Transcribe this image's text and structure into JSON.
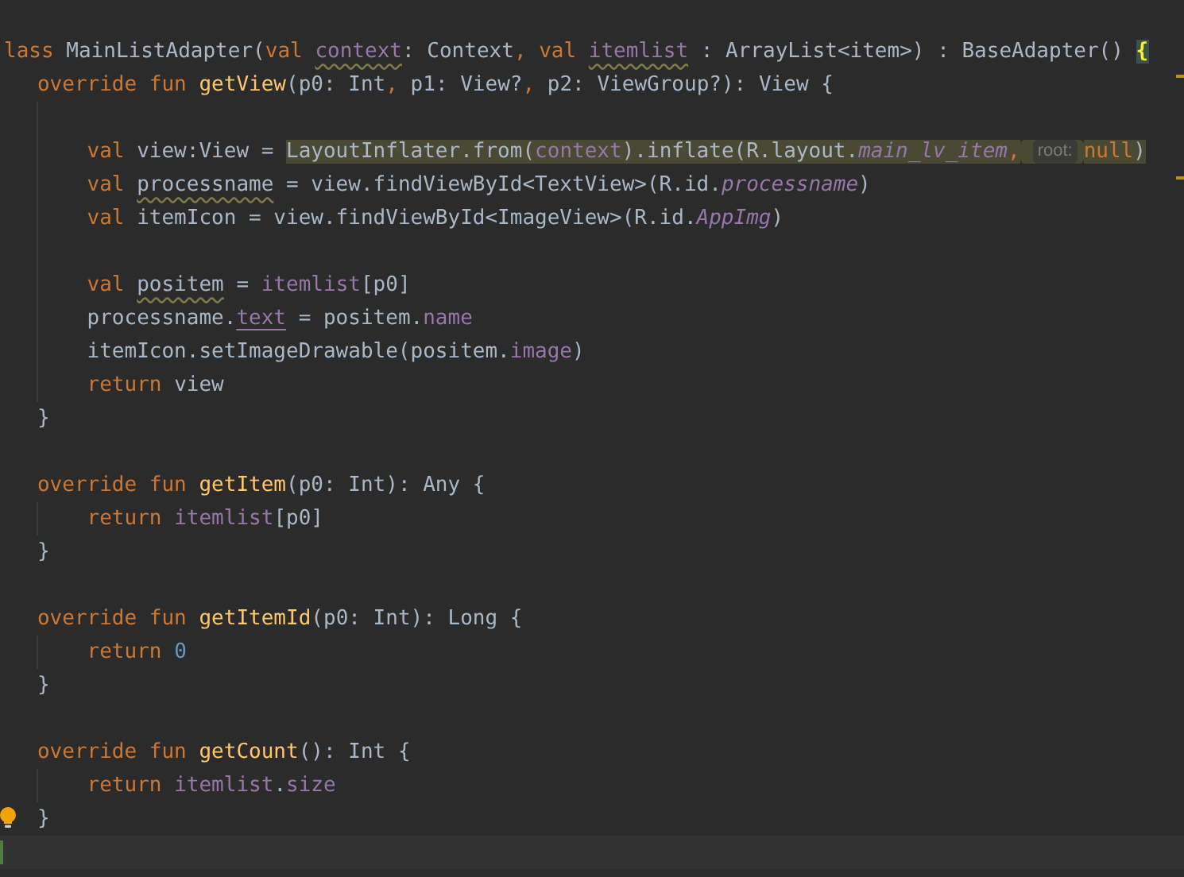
{
  "editor": {
    "lines": [
      {
        "kind": "code",
        "tokens": [
          {
            "text": "lass",
            "kind": "keyword"
          },
          {
            "text": " MainListAdapter(",
            "kind": "plain"
          },
          {
            "text": "val ",
            "kind": "keyword"
          },
          {
            "text": "context",
            "kind": "property",
            "warning": true
          },
          {
            "text": ": Context",
            "kind": "plain"
          },
          {
            "text": ", val ",
            "kind": "keyword"
          },
          {
            "text": "itemlist",
            "kind": "property",
            "warning": true
          },
          {
            "text": " : ArrayList<item>) : BaseAdapter() ",
            "kind": "plain"
          },
          {
            "text": "{",
            "kind": "plain",
            "matched": true
          }
        ],
        "children": [
          {
            "kind": "code",
            "tokens": [
              {
                "text": "override fun ",
                "kind": "keyword"
              },
              {
                "text": "getView",
                "kind": "function"
              },
              {
                "text": "(p0: Int",
                "kind": "plain"
              },
              {
                "text": ",",
                "kind": "keyword"
              },
              {
                "text": " p1: View?",
                "kind": "plain"
              },
              {
                "text": ",",
                "kind": "keyword"
              },
              {
                "text": " p2: ViewGroup?): View {",
                "kind": "plain"
              }
            ],
            "children": [
              {
                "kind": "blank"
              },
              {
                "kind": "code",
                "tokens": [
                  {
                    "text": "val ",
                    "kind": "keyword"
                  },
                  {
                    "text": "view:View = ",
                    "kind": "plain"
                  },
                  {
                    "text": "LayoutInflater.from(",
                    "kind": "plain",
                    "highlight": true
                  },
                  {
                    "text": "context",
                    "kind": "property",
                    "highlight": true
                  },
                  {
                    "text": ").inflate(R.layout.",
                    "kind": "plain",
                    "highlight": true
                  },
                  {
                    "text": "main_lv_item",
                    "kind": "field",
                    "highlight": true
                  },
                  {
                    "text": ",",
                    "kind": "keyword",
                    "highlight": true
                  },
                  {
                    "text": "root:",
                    "kind": "hint",
                    "highlight": true
                  },
                  {
                    "text": "null",
                    "kind": "keyword",
                    "highlight": true
                  },
                  {
                    "text": ")",
                    "kind": "plain",
                    "highlight": true
                  }
                ]
              },
              {
                "kind": "code",
                "tokens": [
                  {
                    "text": "val ",
                    "kind": "keyword"
                  },
                  {
                    "text": "processname",
                    "kind": "plain",
                    "warning": true
                  },
                  {
                    "text": " = view.findViewById<TextView>(R.id.",
                    "kind": "plain"
                  },
                  {
                    "text": "processname",
                    "kind": "field"
                  },
                  {
                    "text": ")",
                    "kind": "plain"
                  }
                ]
              },
              {
                "kind": "code",
                "tokens": [
                  {
                    "text": "val ",
                    "kind": "keyword"
                  },
                  {
                    "text": "itemIcon = view.findViewById<ImageView>(R.id.",
                    "kind": "plain"
                  },
                  {
                    "text": "AppImg",
                    "kind": "field"
                  },
                  {
                    "text": ")",
                    "kind": "plain"
                  }
                ]
              },
              {
                "kind": "blank"
              },
              {
                "kind": "code",
                "tokens": [
                  {
                    "text": "val ",
                    "kind": "keyword"
                  },
                  {
                    "text": "positem",
                    "kind": "plain",
                    "warning": true
                  },
                  {
                    "text": " = ",
                    "kind": "plain"
                  },
                  {
                    "text": "itemlist",
                    "kind": "property"
                  },
                  {
                    "text": "[p0]",
                    "kind": "plain"
                  }
                ]
              },
              {
                "kind": "code",
                "tokens": [
                  {
                    "text": "processname.",
                    "kind": "plain"
                  },
                  {
                    "text": "text",
                    "kind": "property",
                    "underline": true
                  },
                  {
                    "text": " = positem.",
                    "kind": "plain"
                  },
                  {
                    "text": "name",
                    "kind": "property"
                  }
                ]
              },
              {
                "kind": "code",
                "tokens": [
                  {
                    "text": "itemIcon.setImageDrawable(positem.",
                    "kind": "plain"
                  },
                  {
                    "text": "image",
                    "kind": "property"
                  },
                  {
                    "text": ")",
                    "kind": "plain"
                  }
                ]
              },
              {
                "kind": "code",
                "tokens": [
                  {
                    "text": "return ",
                    "kind": "keyword"
                  },
                  {
                    "text": "view",
                    "kind": "plain"
                  }
                ]
              }
            ]
          },
          {
            "kind": "code",
            "tokens": [
              {
                "text": "}",
                "kind": "plain"
              }
            ]
          },
          {
            "kind": "blank"
          },
          {
            "kind": "code",
            "tokens": [
              {
                "text": "override fun ",
                "kind": "keyword"
              },
              {
                "text": "getItem",
                "kind": "function"
              },
              {
                "text": "(p0: Int): Any {",
                "kind": "plain"
              }
            ],
            "children": [
              {
                "kind": "code",
                "tokens": [
                  {
                    "text": "return ",
                    "kind": "keyword"
                  },
                  {
                    "text": "itemlist",
                    "kind": "property"
                  },
                  {
                    "text": "[p0]",
                    "kind": "plain"
                  }
                ]
              }
            ]
          },
          {
            "kind": "code",
            "tokens": [
              {
                "text": "}",
                "kind": "plain"
              }
            ]
          },
          {
            "kind": "blank"
          },
          {
            "kind": "code",
            "tokens": [
              {
                "text": "override fun ",
                "kind": "keyword"
              },
              {
                "text": "getItemId",
                "kind": "function"
              },
              {
                "text": "(p0: Int): Long {",
                "kind": "plain"
              }
            ],
            "children": [
              {
                "kind": "code",
                "tokens": [
                  {
                    "text": "return ",
                    "kind": "keyword"
                  },
                  {
                    "text": "0",
                    "kind": "number"
                  }
                ]
              }
            ]
          },
          {
            "kind": "code",
            "tokens": [
              {
                "text": "}",
                "kind": "plain"
              }
            ]
          },
          {
            "kind": "blank"
          },
          {
            "kind": "code",
            "tokens": [
              {
                "text": "override fun ",
                "kind": "keyword"
              },
              {
                "text": "getCount",
                "kind": "function"
              },
              {
                "text": "(): Int {",
                "kind": "plain"
              }
            ],
            "children": [
              {
                "kind": "code",
                "tokens": [
                  {
                    "text": "return ",
                    "kind": "keyword"
                  },
                  {
                    "text": "itemlist",
                    "kind": "property"
                  },
                  {
                    "text": ".",
                    "kind": "plain"
                  },
                  {
                    "text": "size",
                    "kind": "property"
                  }
                ]
              }
            ]
          },
          {
            "kind": "code",
            "tokens": [
              {
                "text": "}",
                "kind": "plain"
              }
            ],
            "intention_bulb": true
          }
        ]
      },
      {
        "kind": "blank",
        "current": true
      }
    ]
  }
}
